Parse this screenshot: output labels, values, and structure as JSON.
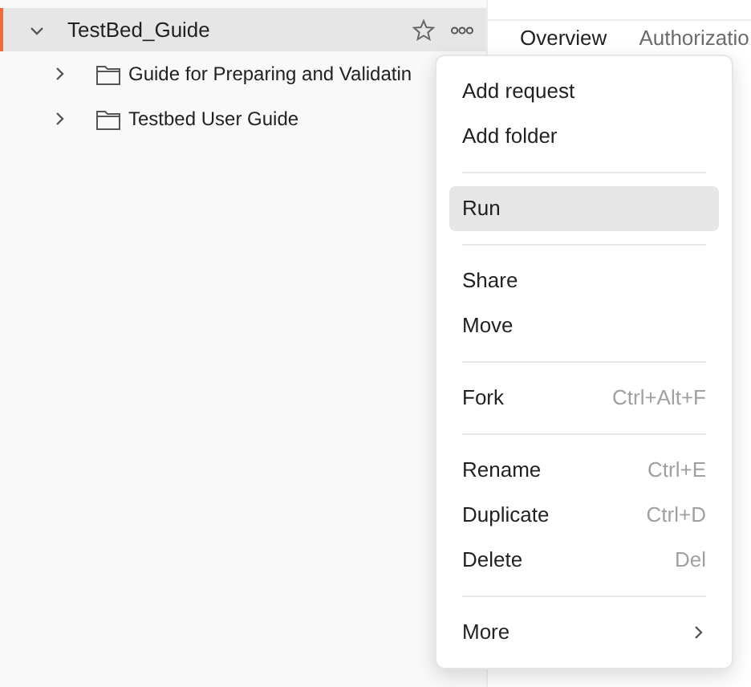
{
  "sidebar": {
    "collection": {
      "name": "TestBed_Guide",
      "expanded": true,
      "selected": true,
      "children": [
        {
          "name": "Guide for Preparing and Validatin",
          "expanded": false
        },
        {
          "name": "Testbed User Guide",
          "expanded": false
        }
      ]
    }
  },
  "tabs": [
    {
      "label": "Overview",
      "selected": false
    },
    {
      "label": "Authorizatio",
      "selected": false
    }
  ],
  "context_menu": {
    "groups": [
      [
        {
          "label": "Add request",
          "selected": false
        },
        {
          "label": "Add folder",
          "selected": false
        }
      ],
      [
        {
          "label": "Run",
          "selected": true
        }
      ],
      [
        {
          "label": "Share",
          "selected": false
        },
        {
          "label": "Move",
          "selected": false
        }
      ],
      [
        {
          "label": "Fork",
          "shortcut": "Ctrl+Alt+F",
          "selected": false
        }
      ],
      [
        {
          "label": "Rename",
          "shortcut": "Ctrl+E",
          "selected": false
        },
        {
          "label": "Duplicate",
          "shortcut": "Ctrl+D",
          "selected": false
        },
        {
          "label": "Delete",
          "shortcut": "Del",
          "selected": false
        }
      ],
      [
        {
          "label": "More",
          "submenu": true,
          "selected": false
        }
      ]
    ]
  }
}
